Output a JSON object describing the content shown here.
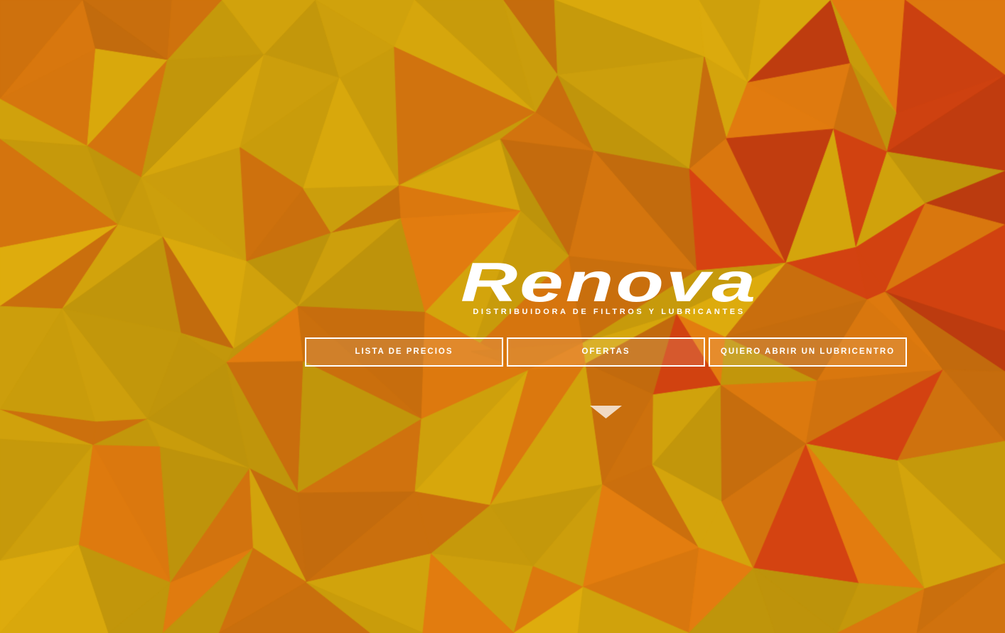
{
  "brand": {
    "name": "Renova",
    "tagline": "DISTRIBUIDORA DE FILTROS Y LUBRICANTES"
  },
  "nav": {
    "buttons": [
      {
        "label": "LISTA DE PRECIOS"
      },
      {
        "label": "OFERTAS"
      },
      {
        "label": "QUIERO ABRIR UN LUBRICENTRO"
      }
    ]
  },
  "colors": {
    "background_yellow": "#d2a30c",
    "background_orange": "#d7760e",
    "background_red": "#cc4010",
    "text": "#ffffff"
  },
  "icons": {
    "scroll": "triangle-down-icon"
  }
}
